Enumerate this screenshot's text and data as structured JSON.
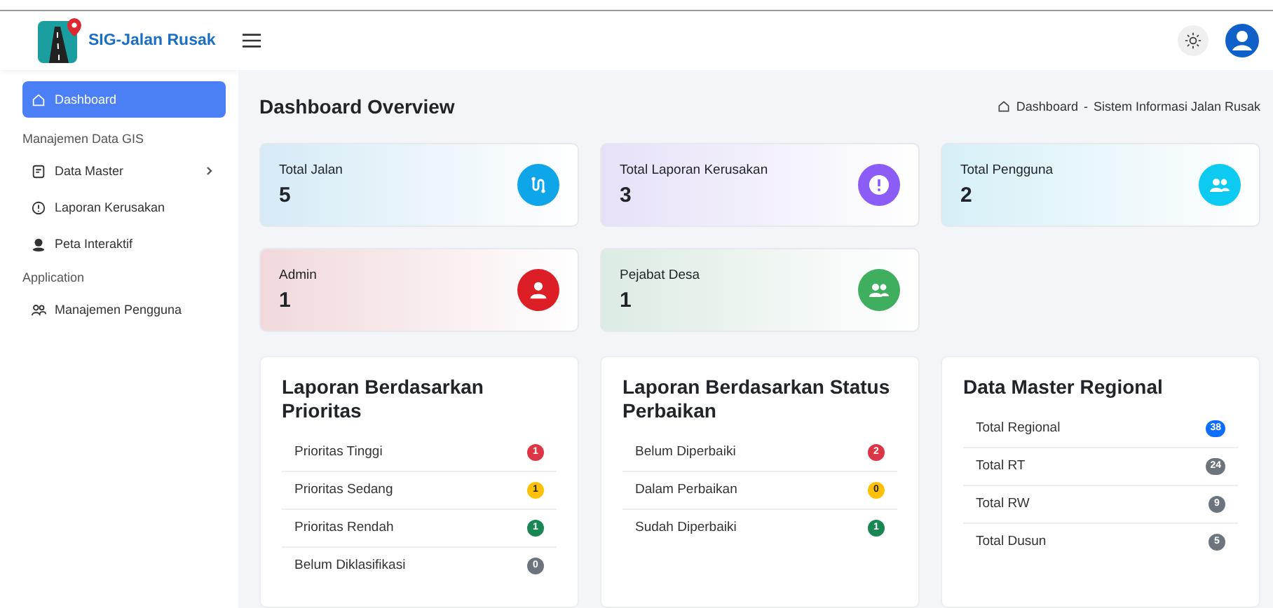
{
  "brand": {
    "name": "SIG-Jalan Rusak"
  },
  "sidebar": {
    "items": [
      {
        "kind": "link",
        "label": "Dashboard",
        "selected": true
      },
      {
        "kind": "header",
        "label": "Manajemen Data GIS"
      },
      {
        "kind": "link",
        "label": "Data Master",
        "selected": false,
        "expanded": false
      },
      {
        "kind": "link",
        "label": "Laporan Kerusakan",
        "selected": false
      },
      {
        "kind": "link",
        "label": "Peta Interaktif",
        "selected": false
      },
      {
        "kind": "header",
        "label": "Application"
      },
      {
        "kind": "link",
        "label": "Manajemen Pengguna",
        "selected": false
      }
    ]
  },
  "page": {
    "title": "Dashboard Overview",
    "breadcrumb": [
      "Dashboard",
      "Sistem Informasi Jalan Rusak"
    ],
    "breadcrumb_separator": "-"
  },
  "stats": [
    {
      "label": "Total Jalan",
      "value": "5",
      "color": "#0ea5e9"
    },
    {
      "label": "Total Laporan Kerusakan",
      "value": "3",
      "color": "#8b5cf6"
    },
    {
      "label": "Total Pengguna",
      "value": "2",
      "color": "#0dcaf0"
    },
    {
      "label": "Admin",
      "value": "1",
      "color": "#dc1f26"
    },
    {
      "label": "Pejabat Desa",
      "value": "1",
      "color": "#3fae5f"
    }
  ],
  "panels": [
    {
      "title": "Laporan Berdasarkan Prioritas",
      "rows": [
        {
          "label": "Prioritas Tinggi",
          "count": "1",
          "color": "#dc3545"
        },
        {
          "label": "Prioritas Sedang",
          "count": "1",
          "color": "#ffc107"
        },
        {
          "label": "Prioritas Rendah",
          "count": "1",
          "color": "#198754"
        },
        {
          "label": "Belum Diklasifikasi",
          "count": "0",
          "color": "#6c757d"
        }
      ]
    },
    {
      "title": "Laporan Berdasarkan Status Perbaikan",
      "rows": [
        {
          "label": "Belum Diperbaiki",
          "count": "2",
          "color": "#dc3545"
        },
        {
          "label": "Dalam Perbaikan",
          "count": "0",
          "color": "#ffc107"
        },
        {
          "label": "Sudah Diperbaiki",
          "count": "1",
          "color": "#198754"
        }
      ]
    },
    {
      "title": "Data Master Regional",
      "rows": [
        {
          "label": "Total Regional",
          "count": "38",
          "color": "#0d6efd"
        },
        {
          "label": "Total RT",
          "count": "24",
          "color": "#6c757d"
        },
        {
          "label": "Total RW",
          "count": "9",
          "color": "#6c757d"
        },
        {
          "label": "Total Dusun",
          "count": "5",
          "color": "#6c757d"
        }
      ]
    }
  ]
}
